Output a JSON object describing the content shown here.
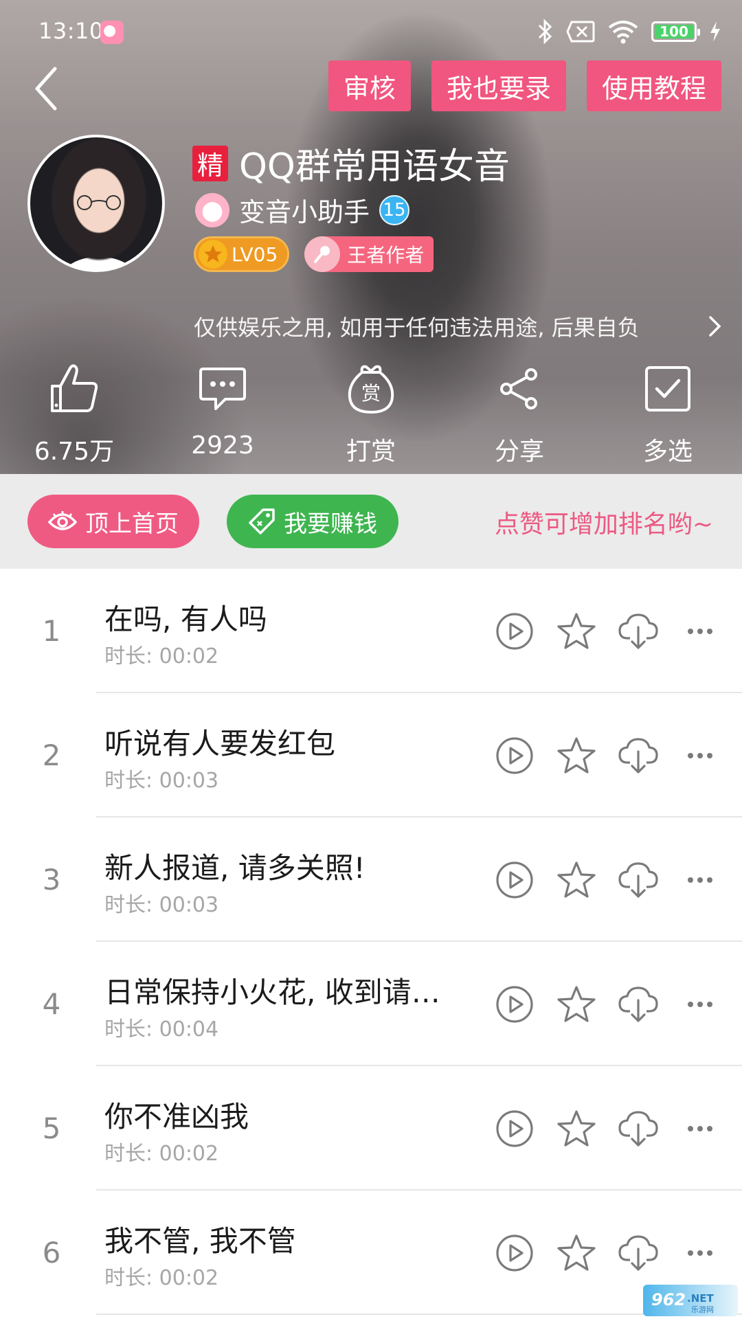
{
  "status_bar": {
    "time": "13:10",
    "battery": "100"
  },
  "top_actions": {
    "review": "审核",
    "record": "我也要录",
    "tutorial": "使用教程"
  },
  "profile": {
    "tag": "精",
    "title": "QQ群常用语女音",
    "author": "变音小助手",
    "vip_level": "15",
    "level_badge": "LV05",
    "honor_badge": "王者作者",
    "description": "仅供娱乐之用, 如用于任何违法用途, 后果自负"
  },
  "stats": [
    {
      "icon": "thumbs-up-icon",
      "label": "6.75万"
    },
    {
      "icon": "comment-icon",
      "label": "2923"
    },
    {
      "icon": "reward-icon",
      "label": "打赏",
      "icon_text": "赏"
    },
    {
      "icon": "share-icon",
      "label": "分享"
    },
    {
      "icon": "checkbox-icon",
      "label": "多选"
    }
  ],
  "promo": {
    "top_home": "顶上首页",
    "earn": "我要赚钱",
    "tip": "点赞可增加排名哟~"
  },
  "tracks": [
    {
      "index": "1",
      "name": "在吗, 有人吗",
      "duration": "时长: 00:02"
    },
    {
      "index": "2",
      "name": "听说有人要发红包",
      "duration": "时长: 00:03"
    },
    {
      "index": "3",
      "name": "新人报道, 请多关照!",
      "duration": "时长: 00:03"
    },
    {
      "index": "4",
      "name": "日常保持小火花, 收到请回复",
      "duration": "时长: 00:04"
    },
    {
      "index": "5",
      "name": "你不准凶我",
      "duration": "时长: 00:02"
    },
    {
      "index": "6",
      "name": "我不管, 我不管",
      "duration": "时长: 00:02"
    }
  ],
  "watermark": "962.NET 乐游网",
  "colors": {
    "accent_pink": "#f0567f",
    "green": "#3fb550",
    "icon_gray": "#7a7a7a"
  }
}
